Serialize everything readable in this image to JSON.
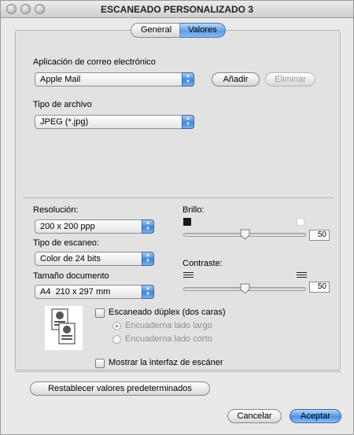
{
  "window": {
    "title": "ESCANEADO PERSONALIZADO 3"
  },
  "tabs": [
    {
      "label": "General",
      "selected": false
    },
    {
      "label": "Valores",
      "selected": true
    }
  ],
  "email": {
    "label": "Aplicación de correo electrónico",
    "selected": "Apple Mail",
    "add_label": "Añadir",
    "remove_label": "Eliminar"
  },
  "filetype": {
    "label": "Tipo de archivo",
    "selected": "JPEG (*.jpg)"
  },
  "resolution": {
    "label": "Resolución:",
    "selected": "200 x 200 ppp"
  },
  "scan_type": {
    "label": "Tipo de escaneo:",
    "selected": "Color de 24 bits"
  },
  "doc_size": {
    "label": "Tamaño documento",
    "selected": "A4  210 x 297 mm"
  },
  "brightness": {
    "label": "Brillo:",
    "value": "50",
    "level_percent": 50
  },
  "contrast": {
    "label": "Contraste:",
    "value": "50",
    "level_percent": 50
  },
  "duplex": {
    "label": "Escaneado dúplex (dos caras)",
    "checked": false,
    "options": [
      "Encuaderna lado largo",
      "Encuaderna lado corto"
    ],
    "selected_index": 0
  },
  "show_interface": {
    "label": "Mostrar la interfaz de escáner",
    "checked": false
  },
  "restore_label": "Restablecer valores predeterminados",
  "cancel_label": "Cancelar",
  "ok_label": "Aceptar",
  "colors": {
    "accent": "#5d9fe6",
    "window_bg": "#e9e9e9"
  }
}
